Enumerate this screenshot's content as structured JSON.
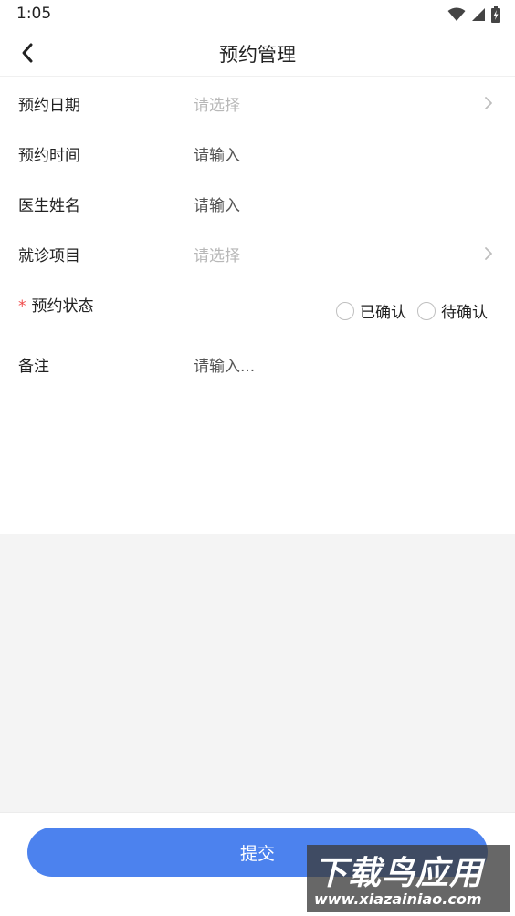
{
  "status_bar": {
    "time": "1:05",
    "icons": [
      "wifi-icon",
      "signal-icon",
      "battery-charging-icon"
    ]
  },
  "nav": {
    "back_icon": "chevron-left-icon",
    "title": "预约管理"
  },
  "form": {
    "date": {
      "label": "预约日期",
      "placeholder": "请选择"
    },
    "time": {
      "label": "预约时间",
      "placeholder": "请输入"
    },
    "doctor": {
      "label": "医生姓名",
      "placeholder": "请输入"
    },
    "item": {
      "label": "就诊项目",
      "placeholder": "请选择"
    },
    "status": {
      "required_mark": "*",
      "label": "预约状态",
      "options": [
        "已确认",
        "待确认"
      ]
    },
    "remark": {
      "label": "备注",
      "placeholder": "请输入..."
    }
  },
  "submit": {
    "label": "提交",
    "color": "#4c82ee"
  },
  "watermark": {
    "main": "下载鸟应用",
    "sub": "www.xiazainiao.com"
  },
  "colors": {
    "required": "#f04a4a",
    "background_gray": "#f4f4f4"
  }
}
